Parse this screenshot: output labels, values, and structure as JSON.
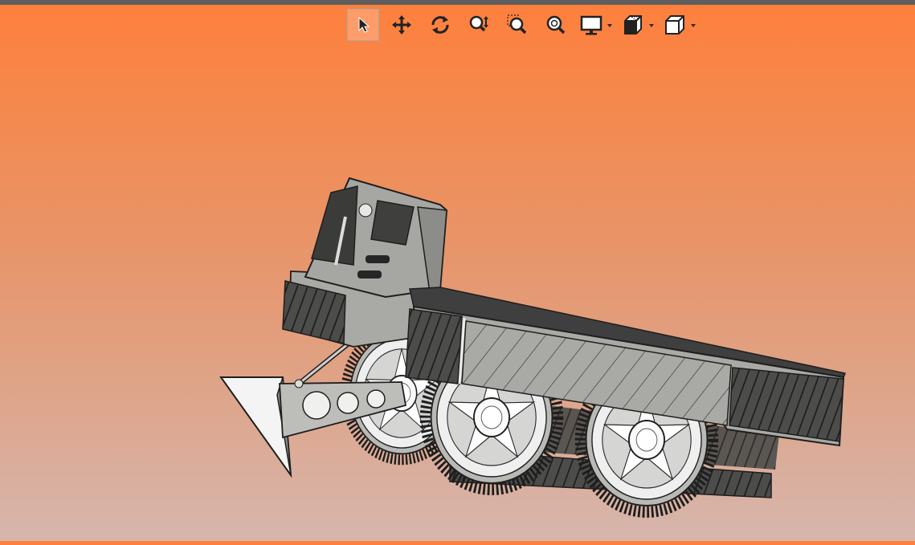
{
  "app": {
    "title_bar_color": "#5e5e5e",
    "background_gradient": [
      "#ff7f3c",
      "#d6b6ad"
    ]
  },
  "toolbar": {
    "items": [
      {
        "icon": "pointer-select-icon",
        "active": true
      },
      {
        "icon": "pan-move-icon",
        "active": false
      },
      {
        "icon": "rotate-icon",
        "active": false
      },
      {
        "icon": "zoom-in-out-icon",
        "active": false
      },
      {
        "icon": "zoom-window-icon",
        "active": false
      },
      {
        "icon": "zoom-fit-icon",
        "active": false
      },
      {
        "icon": "display-style-icon",
        "has_dropdown": true
      },
      {
        "icon": "section-view-icon",
        "has_dropdown": true
      },
      {
        "icon": "view-cube-icon",
        "has_dropdown": true
      }
    ]
  },
  "model": {
    "subject": "tracked-vehicle-3d-model",
    "wheel_count": 3,
    "colors": {
      "body": "#a9aaa5",
      "dark_panel": "#4b4b49",
      "outline": "#1e1e1e",
      "wheel_light": "#efefef"
    }
  }
}
